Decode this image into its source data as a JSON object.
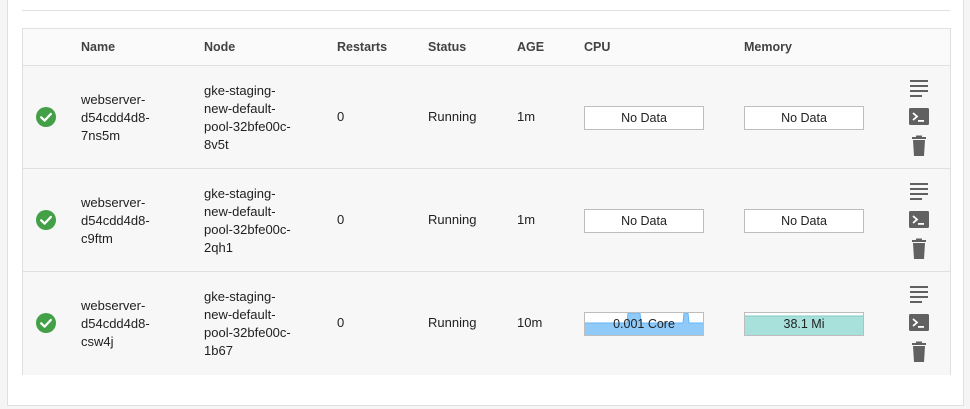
{
  "columns": {
    "name": "Name",
    "node": "Node",
    "restarts": "Restarts",
    "status": "Status",
    "age": "AGE",
    "cpu": "CPU",
    "memory": "Memory"
  },
  "colors": {
    "status_ok": "#43a047",
    "cpu_fill": "#90caf9",
    "cpu_line": "#64b5f6",
    "mem_fill": "#a8e0dc",
    "mem_line": "#80cbc4",
    "icon_grey": "#616161"
  },
  "icons": {
    "status": "check-circle-icon",
    "logs": "logs-icon",
    "exec": "terminal-icon",
    "delete": "delete-icon"
  },
  "pods": [
    {
      "name": "webserver-\nd54cdd4d8-\n7ns5m",
      "node": "gke-staging-\nnew-default-\npool-32bfe00c-\n8v5t",
      "restarts": "0",
      "status": "Running",
      "age": "1m",
      "cpu": "No Data",
      "memory": "No Data"
    },
    {
      "name": "webserver-\nd54cdd4d8-\nc9ftm",
      "node": "gke-staging-\nnew-default-\npool-32bfe00c-\n2qh1",
      "restarts": "0",
      "status": "Running",
      "age": "1m",
      "cpu": "No Data",
      "memory": "No Data"
    },
    {
      "name": "webserver-\nd54cdd4d8-\ncsw4j",
      "node": "gke-staging-\nnew-default-\npool-32bfe00c-\n1b67",
      "restarts": "0",
      "status": "Running",
      "age": "10m",
      "cpu": "0.001 Core",
      "memory": "38.1 Mi"
    }
  ]
}
